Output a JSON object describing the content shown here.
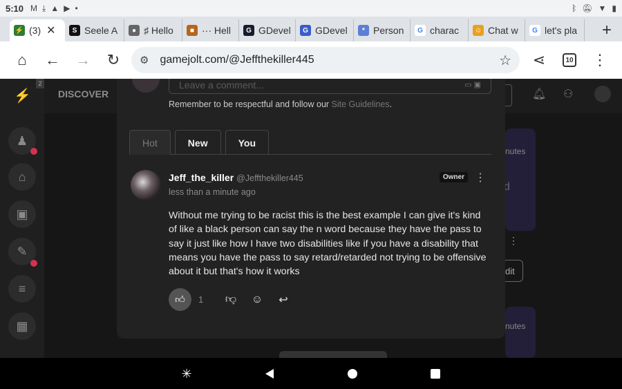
{
  "status": {
    "time": "5:10",
    "icons": [
      "gmail-icon",
      "download-icon",
      "drive-icon",
      "youtube-icon",
      "dot-icon"
    ],
    "right_icons": [
      "bluetooth-icon",
      "mute-icon",
      "wifi-icon",
      "battery-icon"
    ]
  },
  "tabs": [
    {
      "label": "(3) ",
      "active": true,
      "fav_bg": "#2e7d32",
      "fav_text": "⚡"
    },
    {
      "label": "Seele A",
      "fav_bg": "#111",
      "fav_text": "S"
    },
    {
      "label": "♯ Hello",
      "fav_bg": "#666",
      "fav_text": "●"
    },
    {
      "label": "··· Hell",
      "fav_bg": "#b5651d",
      "fav_text": "■"
    },
    {
      "label": "GDevel",
      "fav_bg": "#1a1a2e",
      "fav_text": "G"
    },
    {
      "label": "GDevel",
      "fav_bg": "#3a5bcc",
      "fav_text": "G"
    },
    {
      "label": "Person",
      "fav_bg": "#5b7fd8",
      "fav_text": "*"
    },
    {
      "label": "charac",
      "fav_bg": "#fff",
      "fav_text": "G"
    },
    {
      "label": "Chat w",
      "fav_bg": "#e8a020",
      "fav_text": "☺"
    },
    {
      "label": "let's pla",
      "fav_bg": "#fff",
      "fav_text": "G"
    }
  ],
  "toolbar": {
    "url": "gamejolt.com/@Jeffthekiller445",
    "tab_count": "10"
  },
  "site": {
    "discover": "DISCOVER",
    "badge": "2"
  },
  "comment_box": {
    "placeholder": "Leave a comment...",
    "guidelines_prefix": "Remember to be respectful and follow our ",
    "guidelines_link": "Site Guidelines",
    "guidelines_suffix": "."
  },
  "sort_tabs": [
    "Hot",
    "New",
    "You"
  ],
  "comment": {
    "display_name": "Jeff_the_killer",
    "username": "@Jeffthekiller445",
    "time": "less than a minute ago",
    "owner_badge": "Owner",
    "body": "Without me trying to be racist this is the best example I can give it's kind of like a black person can say the n word because they have the pass to say it just like how I have two disabilities like if you have a disability that means you have the pass to say retard/retarded not trying to be offensive about it but that's how it works",
    "likes": "1"
  },
  "background": {
    "snippet_1": "nutes",
    "snippet_2": "d",
    "snippet_3": "dit",
    "snippet_4": "nutes"
  },
  "colors": {
    "page_bg": "#161616",
    "modal_bg": "#222222",
    "notif_red": "#d1344f"
  }
}
